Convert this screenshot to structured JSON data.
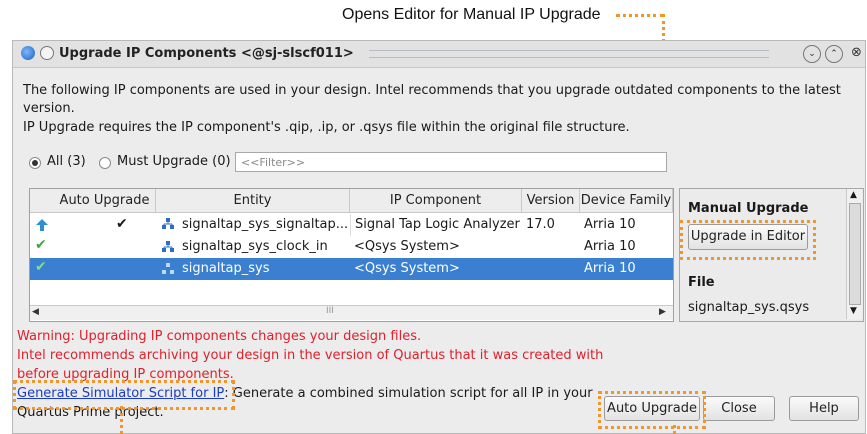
{
  "callout": {
    "top": "Opens Editor for Manual IP Upgrade"
  },
  "window": {
    "title": "Upgrade IP Components <@sj-slscf011>"
  },
  "intro": {
    "line1": "The following IP components are used in your design. Intel recommends that you upgrade outdated components to the latest",
    "line2": "version.",
    "line3": "IP Upgrade requires the IP component's .qip, .ip, or .qsys file within the original file structure."
  },
  "filters": {
    "all_label": "All (3)",
    "must_label": "Must Upgrade (0)",
    "filter_placeholder": "<<Filter>>"
  },
  "table": {
    "columns": [
      "Auto Upgrade",
      "Entity",
      "IP Component",
      "Version",
      "Device Family"
    ],
    "rows": [
      {
        "entity": "signaltap_sys_signaltap...",
        "ip_component": "Signal Tap Logic Analyzer",
        "version": "17.0",
        "family": "Arria 10",
        "auto_upgrade": true,
        "selected": false
      },
      {
        "entity": "signaltap_sys_clock_in",
        "ip_component": "<Qsys System>",
        "version": "",
        "family": "Arria 10",
        "auto_upgrade": false,
        "selected": false
      },
      {
        "entity": "signaltap_sys",
        "ip_component": "<Qsys System>",
        "version": "",
        "family": "Arria 10",
        "auto_upgrade": false,
        "selected": true
      }
    ],
    "scroll_grip": "III"
  },
  "side_panel": {
    "manual_heading": "Manual Upgrade",
    "upgrade_button": "Upgrade in Editor",
    "file_heading": "File",
    "file_name": "signaltap_sys.qsys"
  },
  "warning": {
    "line1": "Warning: Upgrading IP components changes your design files.",
    "line2": "Intel recommends archiving your design in the version of Quartus that it was created with",
    "line3": "before upgrading IP components."
  },
  "simulator": {
    "link": "Generate Simulator Script for IP",
    "desc1": ": Generate a combined simulation script for all IP in your",
    "desc2": "Quartus Prime project."
  },
  "buttons": {
    "auto_upgrade": "Auto Upgrade",
    "close": "Close",
    "help": "Help"
  },
  "colors": {
    "accent_orange": "#f0962a",
    "selection_blue": "#3a7fd0",
    "warning_red": "#e0202c",
    "link_blue": "#1a3cc8"
  },
  "icons": {
    "window": "globe-icon",
    "row_upgrade": "upgrade-arrow-icon",
    "row_ok": "check-icon",
    "entity": "hierarchy-icon"
  }
}
